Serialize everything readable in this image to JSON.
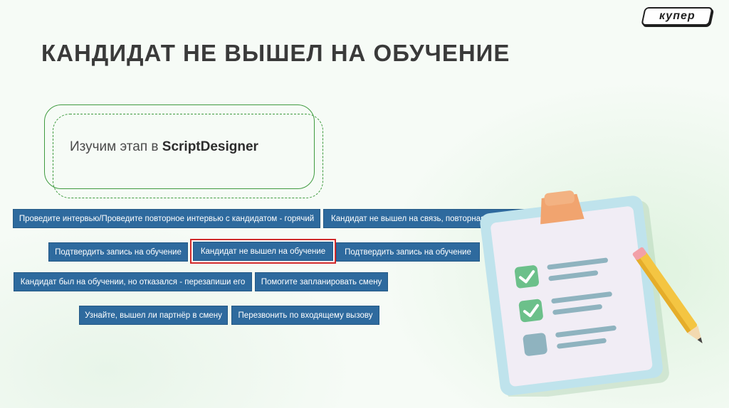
{
  "brand": {
    "logo_text": "купер"
  },
  "title": "КАНДИДАТ НЕ ВЫШЕЛ НА ОБУЧЕНИЕ",
  "callout": {
    "text_prefix": "Изучим этап в ",
    "text_bold": "ScriptDesigner"
  },
  "buttons": {
    "row1": [
      "Проведите интервью/Проведите повторное интервью с кандидатом - горячий",
      "Кандидат не вышел на связь, повторная попытка - го"
    ],
    "row2": [
      "Подтвердить запись на обучение",
      "Кандидат не вышел на обучение",
      "Подтвердить запись на обучение"
    ],
    "row3": [
      "Кандидат был на обучении, но отказался - перезапиши его",
      "Помогите запланировать смену"
    ],
    "row4": [
      "Узнайте, вышел ли партнёр в смену",
      "Перезвонить по входящему вызову"
    ]
  },
  "colors": {
    "button_bg": "#2e6a9e",
    "highlight_border": "#d22b2b",
    "callout_border": "#3f9b3f",
    "title_color": "#3a3a3a"
  },
  "icons": {
    "illustration": "clipboard-checklist-icon",
    "pencil": "pencil-icon"
  }
}
